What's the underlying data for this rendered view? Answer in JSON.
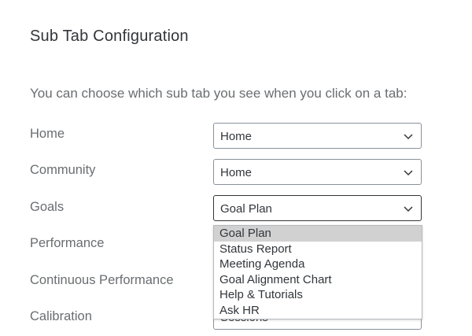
{
  "title": "Sub Tab Configuration",
  "intro": "You can choose which sub tab you see when you click on a tab:",
  "rows": [
    {
      "label": "Home",
      "value": "Home"
    },
    {
      "label": "Community",
      "value": "Home"
    },
    {
      "label": "Goals",
      "value": "Goal Plan"
    },
    {
      "label": "Performance",
      "value": ""
    },
    {
      "label": "Continuous Performance",
      "value": ""
    },
    {
      "label": "Calibration",
      "value": "Sessions"
    }
  ],
  "dropdown": {
    "options": [
      "Goal Plan",
      "Status Report",
      "Meeting Agenda",
      "Goal Alignment Chart",
      "Help & Tutorials",
      "Ask HR"
    ],
    "selected": "Goal Plan"
  },
  "icons": {
    "select_chevron": "chevron-down-icon"
  },
  "colors": {
    "text_primary": "#32363a",
    "text_secondary": "#6a6d70",
    "field_border": "#89919a",
    "option_selected_bg": "#d1d1d1"
  }
}
